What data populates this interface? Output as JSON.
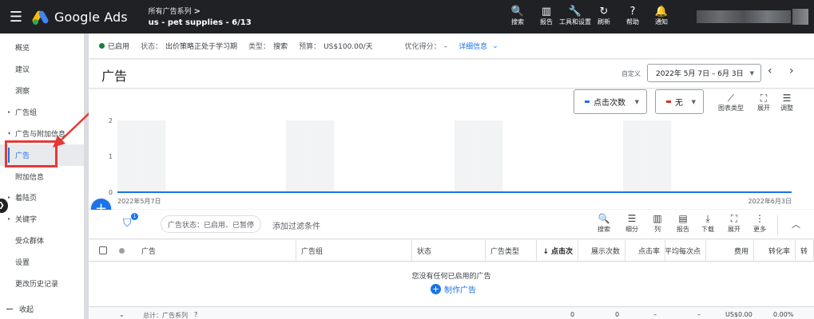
{
  "topbar": {
    "menu_icon": "menu-icon",
    "product": "Google Ads",
    "account_path": "所有广告系列",
    "account_chevron": ">",
    "account_name": "us - pet supplies - 6/13",
    "tools": [
      {
        "icon": "search-icon",
        "glyph": "🔍",
        "label": "搜索"
      },
      {
        "icon": "reports-icon",
        "glyph": "▥",
        "label": "报告"
      },
      {
        "icon": "wrench-icon",
        "glyph": "🔧",
        "label": "工具和设置"
      },
      {
        "icon": "refresh-icon",
        "glyph": "↻",
        "label": "刷新"
      },
      {
        "icon": "help-icon",
        "glyph": "?",
        "label": "帮助"
      },
      {
        "icon": "bell-icon",
        "glyph": "🔔",
        "label": "通知"
      }
    ]
  },
  "sidebar": {
    "items": [
      {
        "label": "概览",
        "arrow": ""
      },
      {
        "label": "建议",
        "arrow": ""
      },
      {
        "label": "洞察",
        "arrow": ""
      },
      {
        "label": "广告组",
        "arrow": "▸"
      },
      {
        "label": "广告与附加信息",
        "arrow": "▾"
      },
      {
        "label": "广告",
        "arrow": "",
        "active": true
      },
      {
        "label": "附加信息",
        "arrow": ""
      },
      {
        "label": "着陆页",
        "arrow": "▸"
      },
      {
        "label": "关键字",
        "arrow": "▸"
      },
      {
        "label": "受众群体",
        "arrow": ""
      },
      {
        "label": "设置",
        "arrow": ""
      },
      {
        "label": "更改历史记录",
        "arrow": ""
      }
    ],
    "collapse_label": "收起",
    "collapse_glyph": "❯"
  },
  "status": {
    "enabled": "已启用",
    "status_key": "状态：",
    "status_value": "出价策略正处于学习期",
    "type_key": "类型：",
    "type_value": "搜索",
    "budget_key": "预算：",
    "budget_value": "US$100.00/天",
    "score_key": "优化得分：",
    "score_value": "–",
    "details_link": "详细信息",
    "details_chevron": "⌄",
    "enabled_color": "#188038"
  },
  "header": {
    "title": "广告",
    "custom_label": "自定义",
    "date_range": "2022年 5月 7日 – 6月 3日",
    "dropdown_glyph": "▼",
    "prev_glyph": "‹",
    "next_glyph": "›"
  },
  "chart_controls": {
    "metric1": "点击次数",
    "metric1_color": "#1a73e8",
    "metric2": "无",
    "metric2_color": "#d93025",
    "dropdown_glyph": "▼",
    "tools": [
      {
        "icon": "chart-type-icon",
        "glyph": "⟋",
        "label": "图表类型"
      },
      {
        "icon": "expand-icon",
        "glyph": "⛶",
        "label": "展开"
      },
      {
        "icon": "adjust-icon",
        "glyph": "☰",
        "label": "调整"
      }
    ]
  },
  "chart_data": {
    "type": "line",
    "x_start_label": "2022年5月7日",
    "x_end_label": "2022年6月3日",
    "y_ticks": [
      0,
      1,
      2
    ],
    "ylim": [
      0,
      2
    ],
    "day_count": 28,
    "shaded_day_indices": [
      0,
      1,
      7,
      8,
      14,
      15,
      21,
      22
    ],
    "series": [
      {
        "values": [
          0,
          0,
          0,
          0,
          0,
          0,
          0,
          0,
          0,
          0,
          0,
          0,
          0,
          0,
          0,
          0,
          0,
          0,
          0,
          0,
          0,
          0,
          0,
          0,
          0,
          0,
          0,
          0
        ],
        "color": "#1a73e8"
      }
    ]
  },
  "fab_glyph": "+",
  "filter": {
    "funnel_glyph": "⛉",
    "badge": "1",
    "chip": "广告状态：已启用、已暂停",
    "add": "添加过滤条件",
    "tools": [
      {
        "icon": "search-icon",
        "glyph": "🔍",
        "label": "搜索"
      },
      {
        "icon": "segment-icon",
        "glyph": "☰",
        "label": "细分"
      },
      {
        "icon": "columns-icon",
        "glyph": "▥",
        "label": "列"
      },
      {
        "icon": "report-icon",
        "glyph": "▤",
        "label": "报告"
      },
      {
        "icon": "download-icon",
        "glyph": "⤓",
        "label": "下载"
      },
      {
        "icon": "expand-icon",
        "glyph": "⛶",
        "label": "展开"
      },
      {
        "icon": "more-icon",
        "glyph": "⋮",
        "label": "更多"
      }
    ],
    "collapse_glyph": "︿"
  },
  "table": {
    "columns": [
      {
        "label": "广告"
      },
      {
        "label": "广告组"
      },
      {
        "label": "状态"
      },
      {
        "label": "广告类型"
      },
      {
        "label": "↓ 点击次"
      },
      {
        "label": "展示次数"
      },
      {
        "label": "点击率"
      },
      {
        "label": "平均每次点"
      },
      {
        "label": "费用"
      },
      {
        "label": "转化率"
      },
      {
        "label": "转"
      }
    ],
    "empty_message": "您没有任何已启用的广告",
    "make_ad": "制作广告",
    "make_ad_glyph": "+",
    "total_row": {
      "chevron": "⌄",
      "label": "总计：广告系列",
      "help": "?",
      "clicks": "0",
      "impressions": "0",
      "ctr": "–",
      "cpc": "–",
      "cost": "US$0.00",
      "conv_rate": "0.00%"
    }
  }
}
